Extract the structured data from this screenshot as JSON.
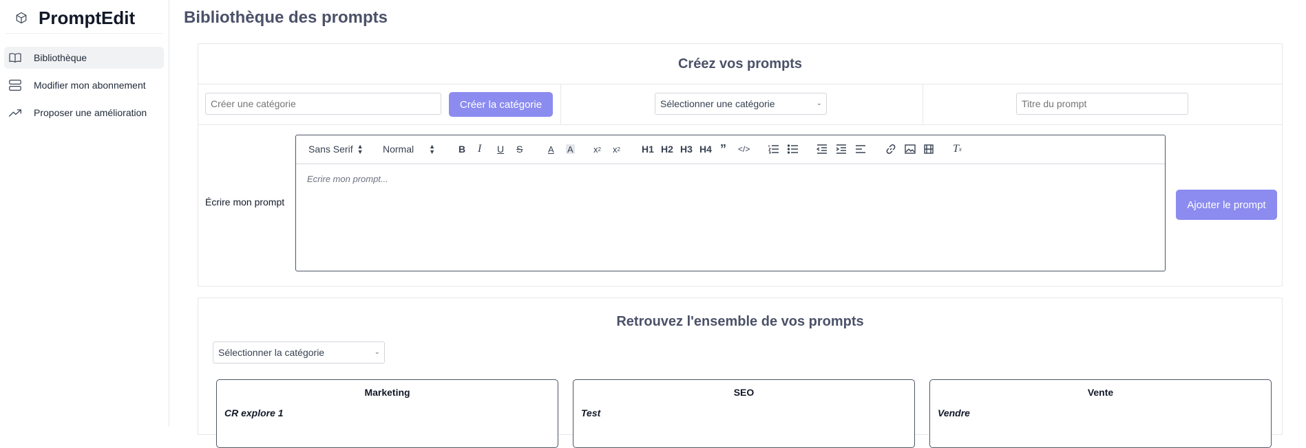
{
  "app": {
    "name": "PromptEdit",
    "logo_icon": "cube-icon"
  },
  "sidebar": {
    "items": [
      {
        "label": "Bibliothèque",
        "icon": "book-open-icon",
        "active": true
      },
      {
        "label": "Modifier mon abonnement",
        "icon": "server-stack-icon",
        "active": false
      },
      {
        "label": "Proposer une amélioration",
        "icon": "trending-up-icon",
        "active": false
      }
    ]
  },
  "page": {
    "title": "Bibliothèque des prompts"
  },
  "create": {
    "title": "Créez vos prompts",
    "category_placeholder": "Créer une catégorie",
    "create_category_label": "Créer la catégorie",
    "select_category": "Sélectionner une catégorie",
    "prompt_title_placeholder": "Titre du prompt",
    "write_label": "Écrire mon prompt",
    "editor_placeholder": "Ecrire mon prompt...",
    "add_prompt_label": "Ajouter le prompt",
    "toolbar": {
      "font": "Sans Serif",
      "size": "Normal",
      "h1": "H1",
      "h2": "H2",
      "h3": "H3",
      "h4": "H4"
    }
  },
  "library": {
    "title": "Retrouvez l'ensemble de vos prompts",
    "select_category": "Sélectionner la catégorie",
    "cards": [
      {
        "category": "Marketing",
        "prompt": "CR explore 1"
      },
      {
        "category": "SEO",
        "prompt": "Test"
      },
      {
        "category": "Vente",
        "prompt": "Vendre"
      }
    ]
  },
  "colors": {
    "accent": "#8b8bf0",
    "heading": "#4b5168",
    "border": "#e5e7eb"
  }
}
